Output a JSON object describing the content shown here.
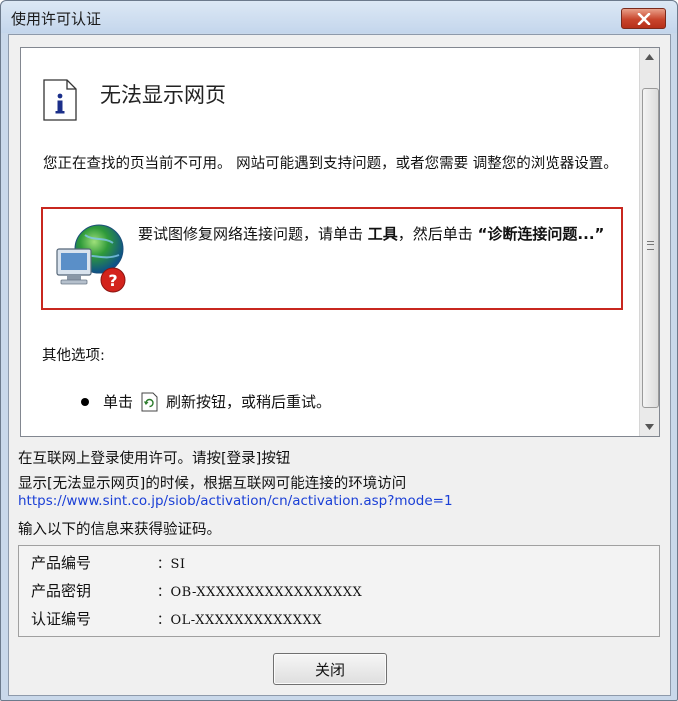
{
  "window": {
    "title": "使用许可认证"
  },
  "webpage": {
    "heading": "无法显示网页",
    "description": "您正在查找的页当前不可用。 网站可能遇到支持问题，或者您需要 调整您的浏览器设置。",
    "diag_prefix": "要试图修复网络连接问题，请单击 ",
    "diag_tools": "工具",
    "diag_middle": "，然后单击 ",
    "diag_action": "“诊断连接问题...”",
    "other_options": "其他选项:",
    "refresh_prefix": "单击",
    "refresh_suffix": "刷新按钮，或稍后重试。"
  },
  "message": {
    "line1": "在互联网上登录使用许可。请按[登录]按钮",
    "line2": "显示[无法显示网页]的时候，根据互联网可能连接的环境访问",
    "url": "https://www.sint.co.jp/siob/activation/cn/activation.asp?mode=1",
    "line4": "输入以下的信息来获得验证码。"
  },
  "info": [
    {
      "key": "产品编号",
      "value": "：SI"
    },
    {
      "key": "产品密钥",
      "value": "：OB-XXXXXXXXXXXXXXXXX"
    },
    {
      "key": "认证编号",
      "value": "：OL-XXXXXXXXXXXXX"
    }
  ],
  "buttons": {
    "close": "关闭"
  },
  "icons": {
    "title_close": "close-icon",
    "info": "info-icon",
    "network": "network-error-icon",
    "refresh": "refresh-icon"
  },
  "colors": {
    "diag_border": "#c8271f",
    "link": "#1a3fd6",
    "close_button": "#c8452c"
  }
}
